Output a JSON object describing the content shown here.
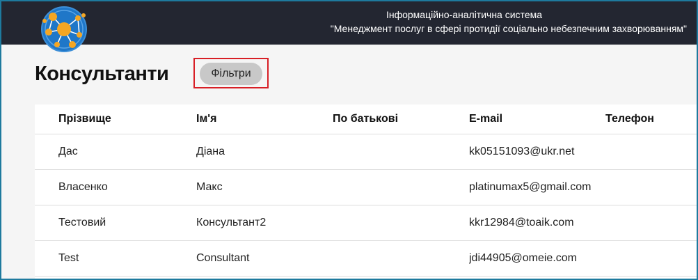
{
  "header": {
    "title_line1": "Інформаційно-аналітична система",
    "title_line2": "\"Менеджмент послуг в сфері протидії соціально небезпечним захворюванням\""
  },
  "page": {
    "title": "Консультанти",
    "filters_label": "Фільтри"
  },
  "table": {
    "columns": [
      "Прізвище",
      "Ім'я",
      "По батькові",
      "E-mail",
      "Телефон"
    ],
    "rows": [
      [
        "Дас",
        "Діана",
        "",
        "kk05151093@ukr.net",
        ""
      ],
      [
        "Власенко",
        "Макс",
        "",
        "platinumax5@gmail.com",
        ""
      ],
      [
        "Тестовий",
        "Консультант2",
        "",
        "kkr12984@toaik.com",
        ""
      ],
      [
        "Test",
        "Consultant",
        "",
        "jdi44905@omeie.com",
        ""
      ]
    ]
  },
  "colors": {
    "header_bg": "#232631",
    "frame_border": "#1e7a9e",
    "highlight": "#d81f26",
    "logo_blue": "#1f77c8",
    "logo_orange": "#f5a623"
  },
  "icons": {
    "logo": "network-globe-icon"
  }
}
